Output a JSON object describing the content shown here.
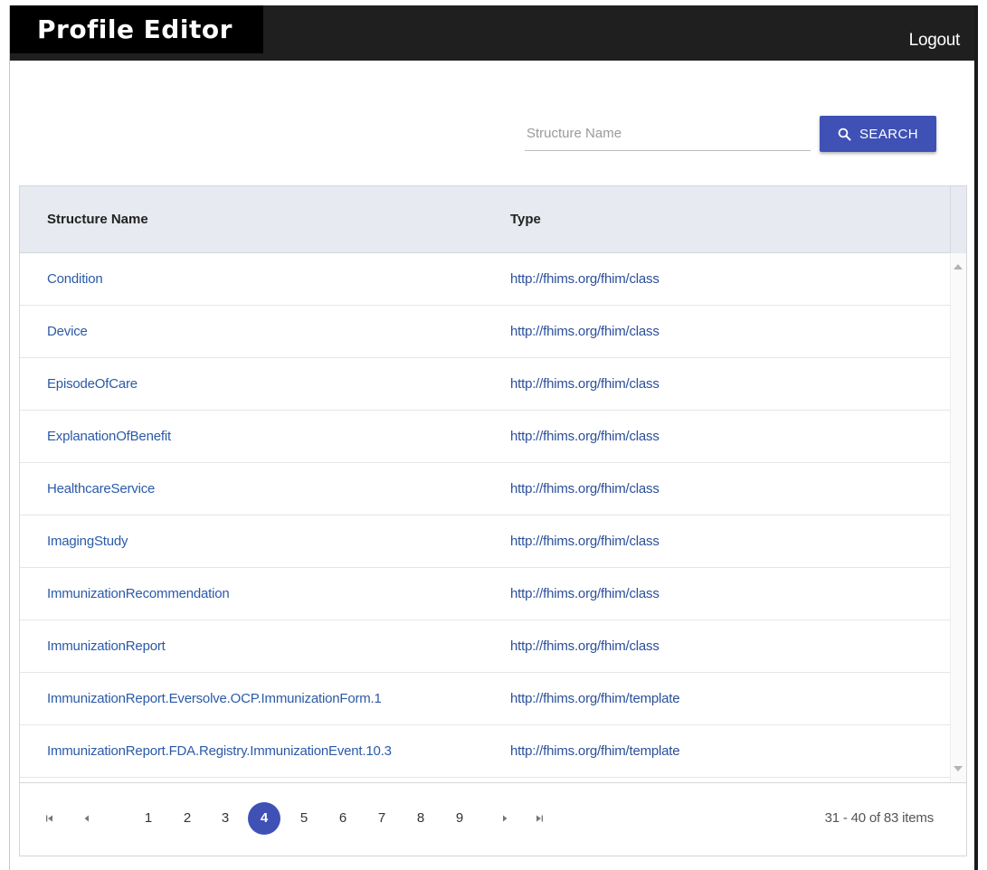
{
  "header": {
    "title": "Profile Editor",
    "logout_label": "Logout"
  },
  "search": {
    "placeholder": "Structure Name",
    "value": "",
    "button_label": "SEARCH"
  },
  "table": {
    "columns": [
      "Structure Name",
      "Type"
    ],
    "rows": [
      {
        "name": "Condition",
        "type": "http://fhims.org/fhim/class"
      },
      {
        "name": "Device",
        "type": "http://fhims.org/fhim/class"
      },
      {
        "name": "EpisodeOfCare",
        "type": "http://fhims.org/fhim/class"
      },
      {
        "name": "ExplanationOfBenefit",
        "type": "http://fhims.org/fhim/class"
      },
      {
        "name": "HealthcareService",
        "type": "http://fhims.org/fhim/class"
      },
      {
        "name": "ImagingStudy",
        "type": "http://fhims.org/fhim/class"
      },
      {
        "name": "ImmunizationRecommendation",
        "type": "http://fhims.org/fhim/class"
      },
      {
        "name": "ImmunizationReport",
        "type": "http://fhims.org/fhim/class"
      },
      {
        "name": "ImmunizationReport.Eversolve.OCP.ImmunizationForm.1",
        "type": "http://fhims.org/fhim/template"
      },
      {
        "name": "ImmunizationReport.FDA.Registry.ImmunizationEvent.10.3",
        "type": "http://fhims.org/fhim/template"
      }
    ]
  },
  "pager": {
    "pages": [
      "1",
      "2",
      "3",
      "4",
      "5",
      "6",
      "7",
      "8",
      "9"
    ],
    "current_page": "4",
    "info": "31 - 40 of 83 items"
  },
  "colors": {
    "topbar": "#1f1f1f",
    "brand_bg": "#000000",
    "accent": "#3f51b5",
    "link": "#2b5aa8",
    "header_bg": "#e7eaf0"
  }
}
